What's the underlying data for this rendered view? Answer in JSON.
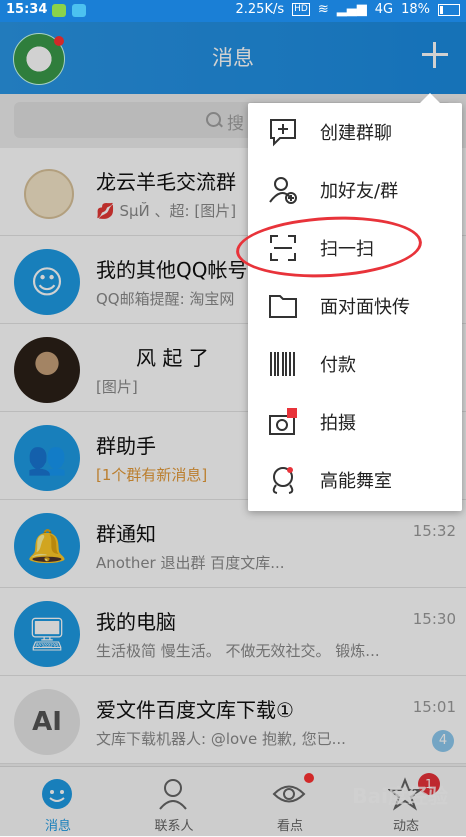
{
  "status_bar": {
    "time": "15:34",
    "speed": "2.25K/s",
    "hd": "HD",
    "network": "4G",
    "battery": "18%"
  },
  "header": {
    "title": "消息"
  },
  "search": {
    "text": "搜"
  },
  "conversations": [
    {
      "name": "龙云羊毛交流群",
      "sub_prefix": "💋",
      "sub": "SµЙ 、超: [图片]",
      "time": ""
    },
    {
      "name": "我的其他QQ帐号",
      "sub": "QQ邮箱提醒: 淘宝网",
      "time": ""
    },
    {
      "name": "风 起 了",
      "sub": "[图片]",
      "time": ""
    },
    {
      "name": "群助手",
      "sub": "[1个群有新消息]",
      "time": ""
    },
    {
      "name": "群通知",
      "sub": "Another 退出群 百度文库...",
      "time": "15:32"
    },
    {
      "name": "我的电脑",
      "sub": "生活极简 慢生活。 不做无效社交。 锻炼...",
      "time": "15:30"
    },
    {
      "name": "爱文件百度文库下载①",
      "sub": "文库下载机器人: @love 抱歉, 您已...",
      "time": "15:01",
      "badge": "4",
      "avatar_text": "AI"
    }
  ],
  "menu": [
    {
      "label": "创建群聊",
      "icon": "create-group-icon"
    },
    {
      "label": "加好友/群",
      "icon": "add-friend-icon"
    },
    {
      "label": "扫一扫",
      "icon": "scan-icon"
    },
    {
      "label": "面对面快传",
      "icon": "folder-icon"
    },
    {
      "label": "付款",
      "icon": "barcode-icon"
    },
    {
      "label": "拍摄",
      "icon": "camera-icon"
    },
    {
      "label": "高能舞室",
      "icon": "dance-icon"
    }
  ],
  "bottom_nav": [
    {
      "label": "消息",
      "icon": "message-icon",
      "active": true
    },
    {
      "label": "联系人",
      "icon": "contacts-icon"
    },
    {
      "label": "看点",
      "icon": "eye-icon"
    },
    {
      "label": "动态",
      "icon": "star-icon",
      "badge": "1"
    }
  ],
  "watermark": "Bai度经验",
  "colors": {
    "primary": "#1e9be5",
    "header": "#2a96e6",
    "highlight_circle": "#e8333a"
  }
}
